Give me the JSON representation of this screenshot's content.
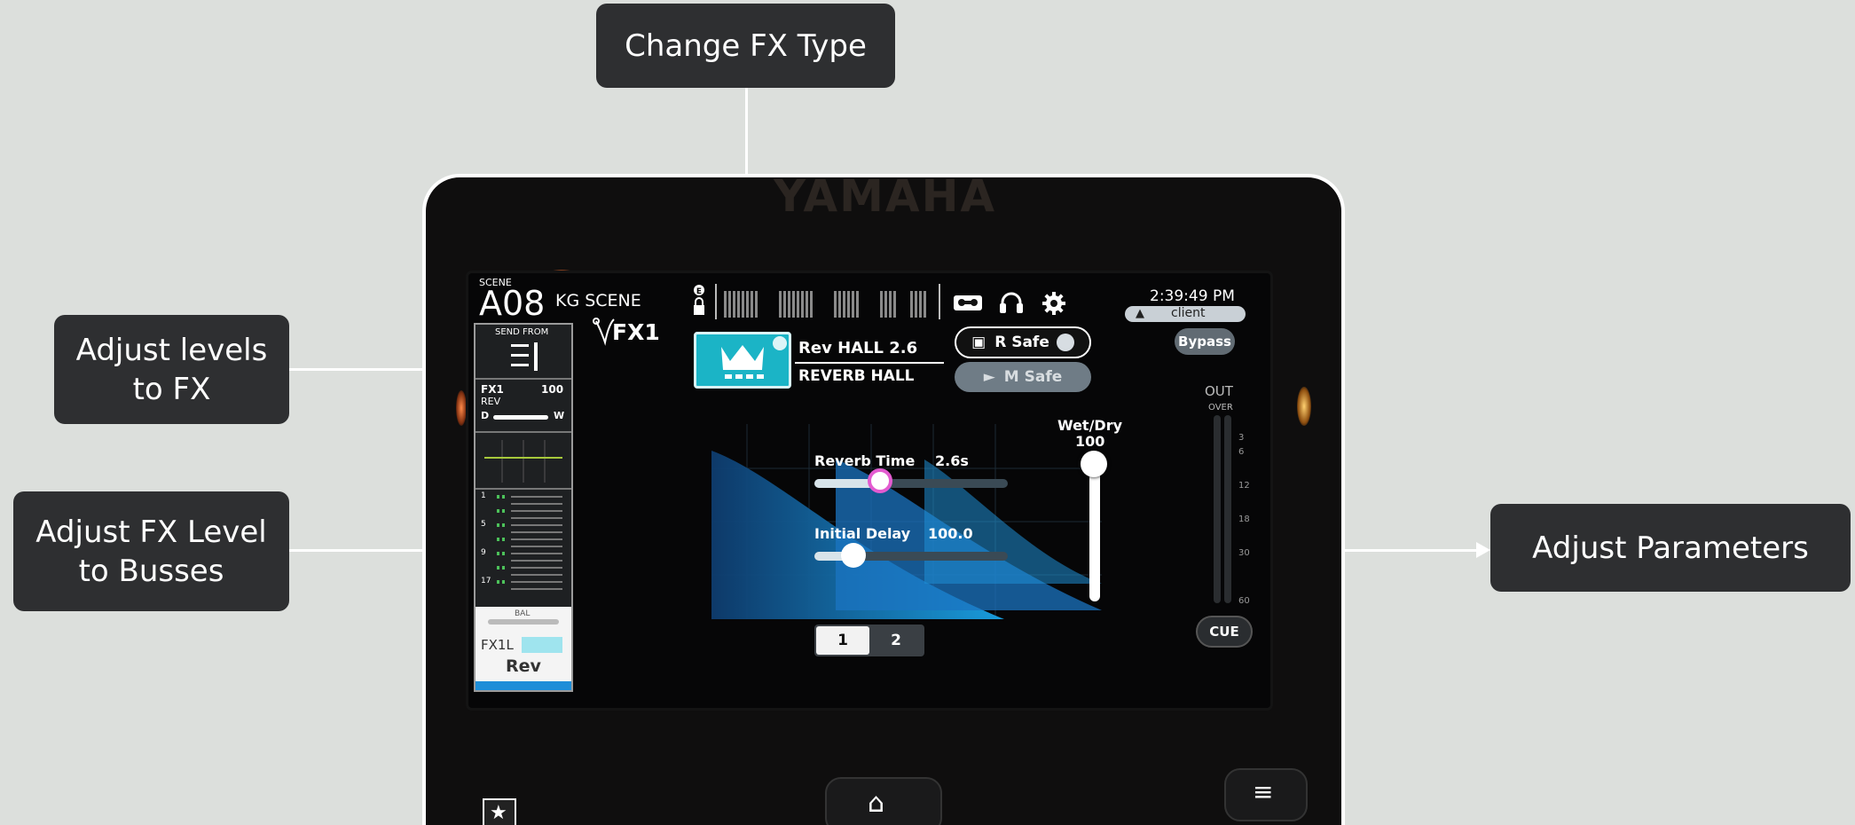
{
  "callouts": {
    "change_fx_type": "Change FX Type",
    "adjust_levels_line1": "Adjust levels",
    "adjust_levels_line2": "to FX",
    "adjust_fx_level_line1": "Adjust FX Level",
    "adjust_fx_level_line2": "to Busses",
    "adjust_parameters": "Adjust Parameters"
  },
  "device": {
    "brand": "YAMAHA"
  },
  "header": {
    "scene_label": "SCENE",
    "scene_number": "A08",
    "scene_name": "KG SCENE",
    "time": "2:39:49 PM",
    "user": "client"
  },
  "channel_strip": {
    "send_from_label": "SEND FROM",
    "fx_name": "FX1",
    "fx_value": "100",
    "fx_type_short": "REV",
    "dry_label": "D",
    "wet_label": "W",
    "bus_numbers": [
      "1",
      "5",
      "9",
      "17"
    ],
    "bal_label": "BAL",
    "channel_label": "FX1L",
    "channel_name": "Rev"
  },
  "fx_panel": {
    "title": "FX1",
    "preset_name": "Rev HALL 2.6",
    "preset_type": "REVERB HALL",
    "recall_safe": "R Safe",
    "mute_safe": "M Safe",
    "bypass": "Bypass",
    "out_label": "OUT",
    "over_label": "OVER",
    "meter_scale": [
      "3",
      "6",
      "12",
      "18",
      "30",
      "60"
    ],
    "cue": "CUE",
    "wet_dry_label": "Wet/Dry",
    "wet_dry_value": "100",
    "wet_dry_level": 1.0,
    "params": [
      {
        "label": "Reverb Time",
        "value": "2.6s",
        "level": 0.34
      },
      {
        "label": "Initial Delay",
        "value": "100.0",
        "level": 0.2
      }
    ],
    "pages": [
      "1",
      "2"
    ],
    "active_page": "1"
  },
  "colors": {
    "accent": "#1bb4c6",
    "knob_pink": "#e35bd0",
    "callout_bg": "#2e2f31"
  }
}
